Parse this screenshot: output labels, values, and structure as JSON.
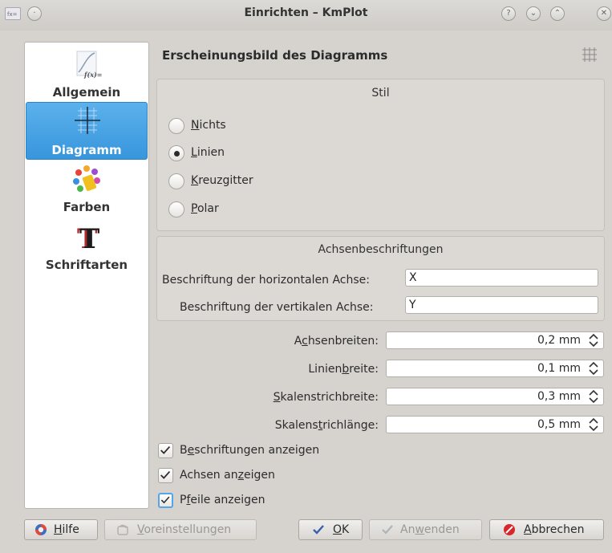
{
  "window": {
    "title": "Einrichten – KmPlot",
    "app_icon_text": "fx="
  },
  "sidebar": {
    "items": [
      {
        "label": "Allgemein",
        "icon": "function-graph-icon",
        "active": false
      },
      {
        "label": "Diagramm",
        "icon": "axes-grid-icon",
        "active": true
      },
      {
        "label": "Farben",
        "icon": "paint-colors-icon",
        "active": false
      },
      {
        "label": "Schriftarten",
        "icon": "font-t-icon",
        "active": false
      }
    ],
    "allgemein_icon_text": "f(x)="
  },
  "page": {
    "title": "Erscheinungsbild des Diagramms"
  },
  "style_group": {
    "title": "Stil",
    "options": [
      {
        "pre": "",
        "key": "N",
        "post": "ichts",
        "checked": false
      },
      {
        "pre": "",
        "key": "L",
        "post": "inien",
        "checked": true
      },
      {
        "pre": "",
        "key": "K",
        "post": "reuzgitter",
        "checked": false
      },
      {
        "pre": "",
        "key": "P",
        "post": "olar",
        "checked": false
      }
    ]
  },
  "labels_group": {
    "title": "Achsenbeschriftungen",
    "horizontal_label": "Beschriftung der horizontalen Achse:",
    "horizontal_value": "X",
    "vertical_label": "Beschriftung der vertikalen Achse:",
    "vertical_value": "Y"
  },
  "spinboxes": [
    {
      "pre": "A",
      "key": "c",
      "post": "hsenbreiten:",
      "value": "0,2 mm"
    },
    {
      "pre": "Linien",
      "key": "b",
      "post": "reite:",
      "value": "0,1 mm"
    },
    {
      "pre": "",
      "key": "S",
      "post": "kalenstrichbreite:",
      "value": "0,3 mm"
    },
    {
      "pre": "Skalens",
      "key": "t",
      "post": "richlänge:",
      "value": "0,5 mm"
    }
  ],
  "checkboxes": [
    {
      "pre": "B",
      "key": "e",
      "post": "schriftungen anzeigen",
      "checked": true
    },
    {
      "pre": "Achsen an",
      "key": "z",
      "post": "eigen",
      "checked": true
    },
    {
      "pre": "P",
      "key": "f",
      "post": "eile anzeigen",
      "checked": true
    }
  ],
  "buttons": {
    "help": {
      "key": "H",
      "post": "ilfe"
    },
    "defaults": {
      "key": "V",
      "post": "oreinstellungen"
    },
    "ok": {
      "key": "O",
      "post": "K"
    },
    "apply": {
      "pre": "An",
      "key": "w",
      "post": "enden"
    },
    "cancel": {
      "key": "A",
      "post": "bbrechen"
    }
  },
  "colors": {
    "accent": "#3896dc",
    "window_bg": "#d6d3cf",
    "group_bg": "#dcd9d5",
    "cancel_icon": "#d8272b"
  }
}
